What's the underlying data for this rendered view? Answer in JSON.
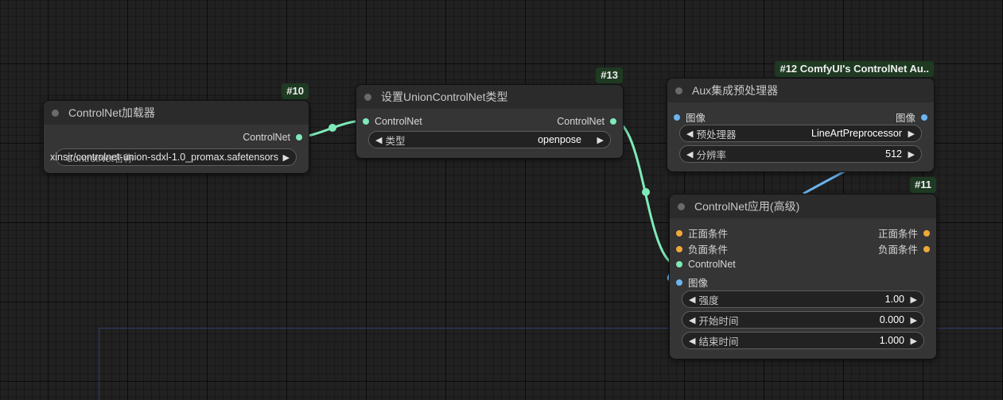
{
  "colors": {
    "link_controlnet": "#7eeab9",
    "link_image": "#6cb4f0",
    "slot_conditioning": "#f0a83a"
  },
  "nodes": {
    "loader": {
      "id": "#10",
      "title": "ControlNet加载器",
      "output": "ControlNet",
      "widget_label": "ControlNet名称",
      "widget_value": "xinsir/controlnet-union-sdxl-1.0_promax.safetensors"
    },
    "union_type": {
      "id": "#13",
      "title": "设置UnionControlNet类型",
      "input": "ControlNet",
      "output": "ControlNet",
      "widget_label": "类型",
      "widget_value": "openpose"
    },
    "aux": {
      "id": "#12 ComfyUI's ControlNet Au..",
      "title": "Aux集成预处理器",
      "input": "图像",
      "output": "图像",
      "widgets": [
        {
          "label": "预处理器",
          "value": "LineArtPreprocessor"
        },
        {
          "label": "分辨率",
          "value": "512"
        }
      ]
    },
    "apply": {
      "id": "#11",
      "title": "ControlNet应用(高级)",
      "inputs": [
        "正面条件",
        "负面条件",
        "ControlNet",
        "图像"
      ],
      "outputs": [
        "正面条件",
        "负面条件"
      ],
      "widgets": [
        {
          "label": "强度",
          "value": "1.00"
        },
        {
          "label": "开始时间",
          "value": "0.000"
        },
        {
          "label": "结束时间",
          "value": "1.000"
        }
      ]
    }
  }
}
